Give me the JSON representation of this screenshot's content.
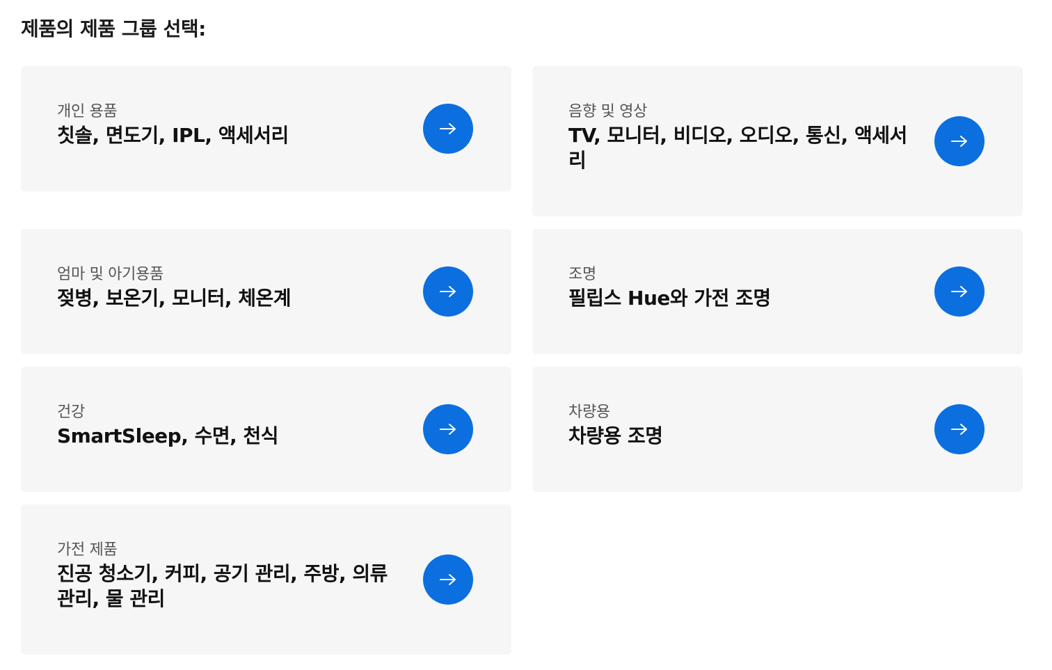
{
  "page": {
    "title": "제품의 제품 그룹 선택:"
  },
  "cards": [
    {
      "category": "개인 용품",
      "products": "칫솔, 면도기, IPL, 액세서리"
    },
    {
      "category": "음향 및 영상",
      "products": "TV, 모니터, 비디오, 오디오, 통신, 액세서리"
    },
    {
      "category": "엄마 및 아기용품",
      "products": "젖병, 보온기, 모니터, 체온계"
    },
    {
      "category": "조명",
      "products": "필립스 Hue와 가전 조명"
    },
    {
      "category": "건강",
      "products": "SmartSleep, 수면, 천식"
    },
    {
      "category": "차량용",
      "products": "차량용 조명"
    },
    {
      "category": "가전 제품",
      "products": "진공 청소기, 커피, 공기 관리, 주방, 의류 관리, 물 관리"
    }
  ],
  "icons": {
    "arrow": "arrow-right-icon"
  },
  "colors": {
    "accent": "#0b6fe0",
    "card_background": "#f6f6f6",
    "category_text": "#555555",
    "product_text": "#111111"
  }
}
